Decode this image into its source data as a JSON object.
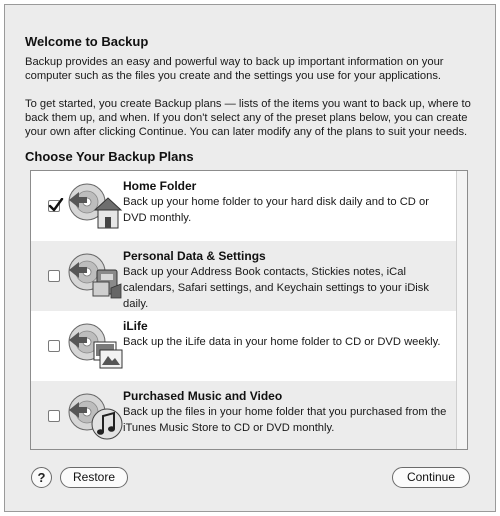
{
  "dialog": {
    "title": "Welcome to Backup",
    "intro_p1": "Backup provides an easy and powerful way to back up important information on your computer such as the files you create and the settings you use for your applications.",
    "intro_p2": "To get started, you create Backup plans — lists of the items you want to back up, where to back them up, and when. If you don't select any of the preset plans below, you can create your own after clicking Continue. You can later modify any of the plans to suit your needs."
  },
  "plans_section": {
    "title": "Choose Your Backup Plans",
    "items": [
      {
        "name": "Home Folder",
        "description": "Back up your home folder to your hard disk daily and to CD or DVD monthly.",
        "checked": true,
        "icon": "home-folder-icon"
      },
      {
        "name": "Personal Data & Settings",
        "description": "Back up your Address Book contacts, Stickies notes, iCal calendars, Safari settings, and Keychain settings to your iDisk daily.",
        "checked": false,
        "icon": "personal-data-icon"
      },
      {
        "name": "iLife",
        "description": "Back up the iLife data in your home folder to CD or DVD weekly.",
        "checked": false,
        "icon": "ilife-icon"
      },
      {
        "name": "Purchased Music and Video",
        "description": "Back up the files in your home folder that you purchased from the iTunes Music Store to CD or DVD monthly.",
        "checked": false,
        "icon": "music-video-icon"
      }
    ]
  },
  "footer": {
    "help_label": "?",
    "restore_label": "Restore",
    "continue_label": "Continue"
  }
}
